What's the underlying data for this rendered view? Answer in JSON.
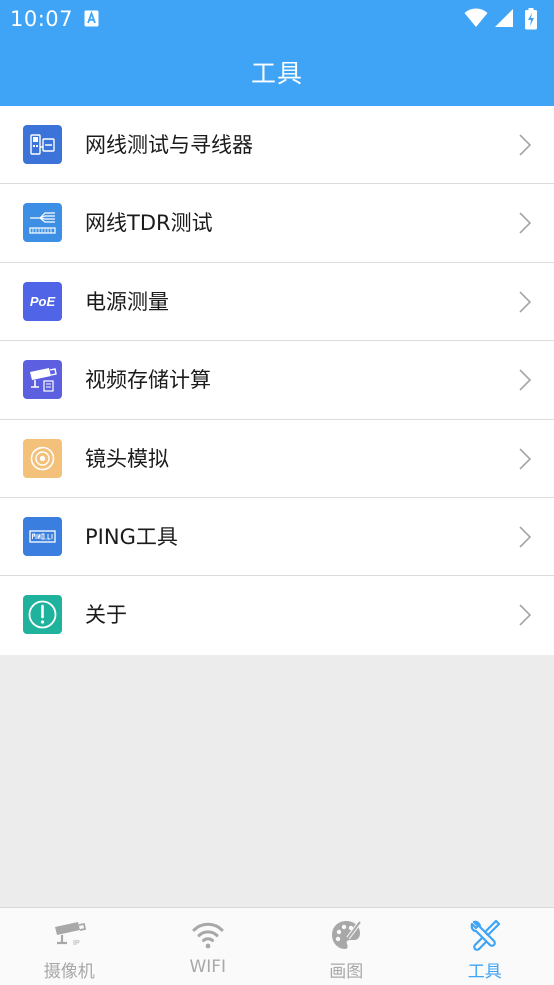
{
  "status_bar": {
    "time": "10:07",
    "notification_icon": "a-letter-icon",
    "icons": [
      "wifi-icon",
      "cellular-signal-icon",
      "battery-charging-icon"
    ]
  },
  "app_bar": {
    "title": "工具"
  },
  "menu": {
    "items": [
      {
        "label": "网线测试与寻线器",
        "icon": "cable-tester-icon",
        "icon_color": "#3b73d8"
      },
      {
        "label": "网线TDR测试",
        "icon": "network-cable-tdr-icon",
        "icon_color": "#3d8fe6"
      },
      {
        "label": "电源测量",
        "icon": "poe-icon",
        "icon_color": "#4f64e6",
        "icon_text": "PoE"
      },
      {
        "label": "视频存储计算",
        "icon": "camera-storage-icon",
        "icon_color": "#5b5fe0"
      },
      {
        "label": "镜头模拟",
        "icon": "lens-icon",
        "icon_color": "#f3c17a"
      },
      {
        "label": "PING工具",
        "icon": "ping-terminal-icon",
        "icon_color": "#3a7ee0"
      },
      {
        "label": "关于",
        "icon": "exclamation-icon",
        "icon_color": "#1fb39d"
      }
    ]
  },
  "tab_bar": {
    "active_index": 3,
    "active_color": "#3fa4f6",
    "inactive_color": "#a8a8a8",
    "tabs": [
      {
        "label": "摄像机",
        "icon": "ip-camera-icon"
      },
      {
        "label": "WIFI",
        "icon": "wifi-icon"
      },
      {
        "label": "画图",
        "icon": "palette-icon"
      },
      {
        "label": "工具",
        "icon": "tools-icon"
      }
    ]
  }
}
